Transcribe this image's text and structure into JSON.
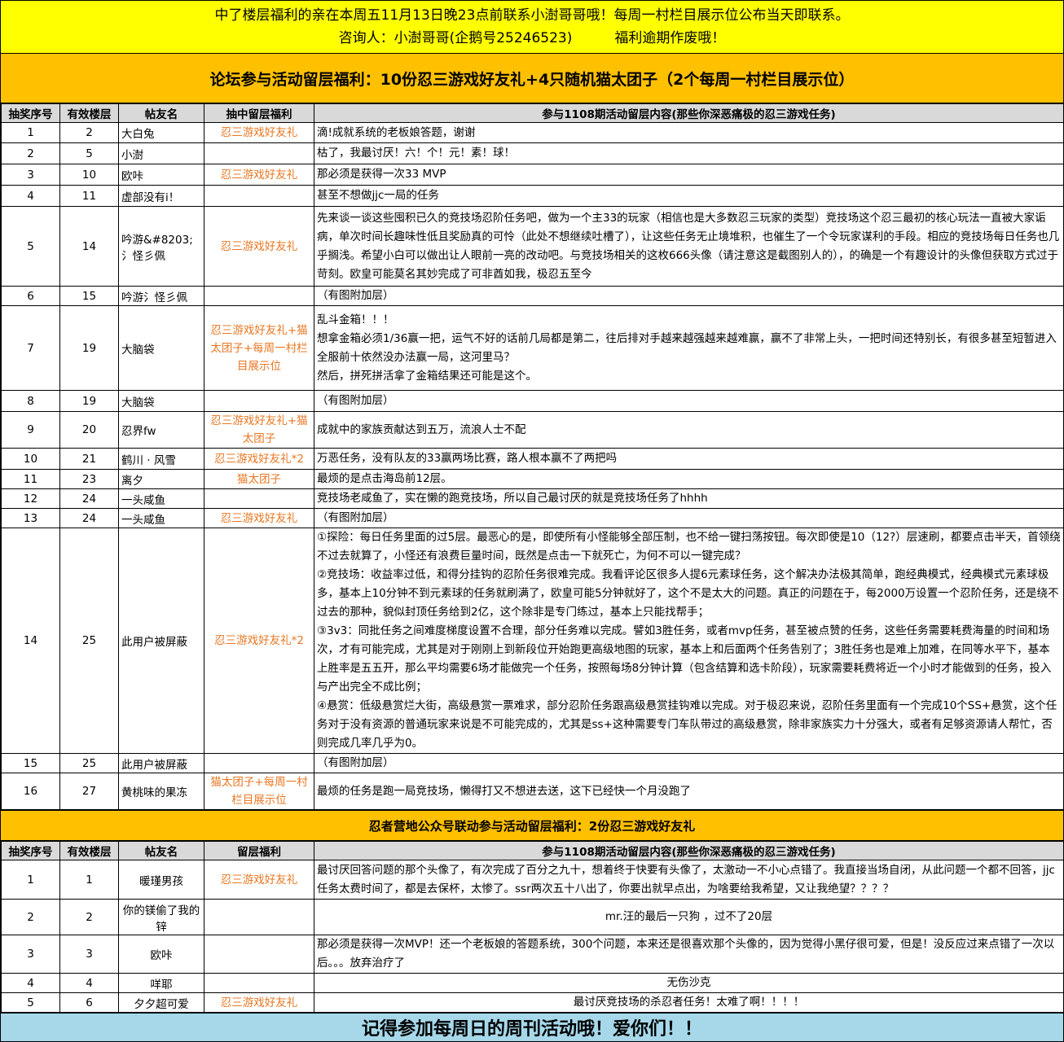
{
  "notice": {
    "line1": "中了楼层福利的亲在本周五11月13日晚23点前联系小澍哥哥哦！每周一村栏目展示位公布当天即联系。",
    "contact": "咨询人：小澍哥哥(企鹅号25246523)",
    "expiry": "福利逾期作废哦！"
  },
  "section1": {
    "title": "论坛参与活动留层福利：10份忍三游戏好友礼+4只随机猫太团子（2个每周一村栏目展示位）",
    "headers": [
      "抽奖序号",
      "有效楼层",
      "帖友名",
      "抽中留层福利",
      "参与1108期活动留层内容(那些你深恶痛极的忍三游戏任务)"
    ],
    "rows": [
      {
        "no": "1",
        "floor": "2",
        "name": "大白兔",
        "prize": "忍三游戏好友礼",
        "content": [
          "滴!成就系统的老板娘答题，谢谢"
        ]
      },
      {
        "no": "2",
        "floor": "5",
        "name": "小澍",
        "prize": "",
        "content": [
          "枯了，我最讨厌！六！个！元！素！球！"
        ]
      },
      {
        "no": "3",
        "floor": "10",
        "name": "欧咔",
        "prize": "忍三游戏好友礼",
        "content": [
          "那必须是获得一次33 MVP"
        ]
      },
      {
        "no": "4",
        "floor": "11",
        "name": "虚部没有i！",
        "prize": "",
        "content": [
          "甚至不想做jjc一局的任务"
        ]
      },
      {
        "no": "5",
        "floor": "14",
        "name": "吟游&#8203;氵怪彡佩",
        "prize": "忍三游戏好友礼",
        "content": [
          "先来谈一谈这些囤积已久的竞技场忍阶任务吧，做为一个主33的玩家（相信也是大多数忍三玩家的类型）竞技场这个忍三最初的核心玩法一直被大家诟病，单次时间长趣味性低且奖励真的可怜（此处不想继续吐槽了），让这些任务无止境堆积，也催生了一个令玩家谋利的手段。相应的竞技场每日任务也几乎搁浅。希望小白可以做出让人眼前一亮的改动吧。与竞技场相关的这枚666头像（请注意这是截图别人的），的确是一个有趣设计的头像但获取方式过于苛刻。欧皇可能莫名其妙完成了可非酋如我，极忍五至今"
        ]
      },
      {
        "no": "6",
        "floor": "15",
        "name": "吟游氵怪彡佩",
        "prize": "",
        "content": [
          "（有图附加层）"
        ]
      },
      {
        "no": "7",
        "floor": "19",
        "name": "大脑袋",
        "prize": "忍三游戏好友礼+猫太团子+每周一村栏目展示位",
        "content": [
          "乱斗金箱！！！",
          "想拿金箱必须1/36赢一把，运气不好的话前几局都是第二，往后排对手越来越强越来越难赢，赢不了非常上头，一把时间还特别长，有很多甚至短暂进入全服前十依然没办法赢一局，这河里马？",
          "然后，拼死拼活拿了金箱结果还可能是这个。"
        ]
      },
      {
        "no": "8",
        "floor": "19",
        "name": "大脑袋",
        "prize": "",
        "content": [
          "（有图附加层）"
        ]
      },
      {
        "no": "9",
        "floor": "20",
        "name": "忍界fw",
        "prize": "忍三游戏好友礼+猫太团子",
        "content": [
          "成就中的家族贡献达到五万，流浪人士不配"
        ]
      },
      {
        "no": "10",
        "floor": "21",
        "name": "鹤川 · 风雪",
        "prize": "忍三游戏好友礼*2",
        "content": [
          "万恶任务，没有队友的33赢两场比赛，路人根本赢不了两把吗"
        ]
      },
      {
        "no": "11",
        "floor": "23",
        "name": "离夕",
        "prize": "猫太团子",
        "content": [
          "最烦的是点击海岛前12层。"
        ]
      },
      {
        "no": "12",
        "floor": "24",
        "name": "一头咸鱼",
        "prize": "",
        "content": [
          "竞技场老咸鱼了，实在懒的跑竞技场，所以自己最讨厌的就是竞技场任务了hhhh"
        ]
      },
      {
        "no": "13",
        "floor": "24",
        "name": "一头咸鱼",
        "prize": "忍三游戏好友礼",
        "content": [
          "（有图附加层）"
        ]
      },
      {
        "no": "14",
        "floor": "25",
        "name": "此用户被屏蔽",
        "prize": "忍三游戏好友礼*2",
        "content": [
          "①探险：每日任务里面的过5层。最恶心的是，即使所有小怪能够全部压制，也不给一键扫荡按钮。每次即使是10（12?）层速刷，都要点击半天，首领绕不过去就算了，小怪还有浪费巨量时间，既然是点击一下就死亡，为何不可以一键完成？",
          "②竞技场：收益率过低，和得分挂钩的忍阶任务很难完成。我看评论区很多人提6元素球任务，这个解决办法极其简单，跑经典模式，经典模式元素球极多，基本上10分钟不到元素球的任务就刷满了，欧皇可能5分钟就好了，这个不是太大的问题。真正的问题在于，每2000万设置一个忍阶任务，还是绕不过去的那种，貌似封顶任务给到2亿，这个除非是专门练过，基本上只能找帮手；",
          "③3v3：同批任务之间难度梯度设置不合理，部分任务难以完成。譬如3胜任务，或者mvp任务，甚至被点赞的任务，这些任务需要耗费海量的时间和场次，才有可能完成，尤其是对于刚刚上到新段位开始跑更高级地图的玩家，基本上和后面两个任务告别了；3胜任务也是难上加难，在同等水平下，基本上胜率是五五开，那么平均需要6场才能做完一个任务，按照每场8分钟计算（包含结算和选卡阶段），玩家需要耗费将近一个小时才能做到的任务，投入与产出完全不成比例；",
          "④悬赏：低级悬赏烂大街，高级悬赏一票难求，部分忍阶任务跟高级悬赏挂钩难以完成。对于极忍来说，忍阶任务里面有一个完成10个SS+悬赏，这个任务对于没有资源的普通玩家来说是不可能完成的，尤其是ss+这种需要专门车队带过的高级悬赏，除非家族实力十分强大，或者有足够资源请人帮忙，否则完成几率几乎为0。"
        ]
      },
      {
        "no": "15",
        "floor": "25",
        "name": "此用户被屏蔽",
        "prize": "",
        "content": [
          "（有图附加层）"
        ]
      },
      {
        "no": "16",
        "floor": "27",
        "name": "黄桃味的果冻",
        "prize": "猫太团子+每周一村栏目展示位",
        "content": [
          "最烦的任务是跑一局竞技场，懒得打又不想进去送，这下已经快一个月没跑了"
        ]
      }
    ]
  },
  "section2": {
    "title": "忍者营地公众号联动参与活动留层福利：2份忍三游戏好友礼",
    "headers": [
      "抽奖序号",
      "有效楼层",
      "帖友名",
      "留层福利",
      "参与1108期活动留层内容(那些你深恶痛极的忍三游戏任务)"
    ],
    "rows": [
      {
        "no": "1",
        "floor": "1",
        "name": "暖瑾男孩",
        "prize": "忍三游戏好友礼",
        "content": [
          "最讨厌回答问题的那个头像了，有次完成了百分之九十，想着终于快要有头像了，太激动一不小心点错了。我直接当场自闭，从此问题一个都不回答，jjc任务太费时间了，都是去保杯，太惨了。ssr两次五十八出了，你要出就早点出，为啥要给我希望，又让我绝望？？？？"
        ]
      },
      {
        "no": "2",
        "floor": "2",
        "name": "你的镁偷了我的锌",
        "prize": "",
        "content": [
          "mr.汪的最后一只狗 ，过不了20层"
        ]
      },
      {
        "no": "3",
        "floor": "3",
        "name": "欧咔",
        "prize": "",
        "content": [
          "那必须是获得一次MVP！还一个老板娘的答题系统，300个问题，本来还是很喜欢那个头像的，因为觉得小黑仔很可爱，但是！没反应过来点错了一次以后。。。放弃治疗了"
        ]
      },
      {
        "no": "4",
        "floor": "4",
        "name": "咩耶",
        "prize": "",
        "content": [
          "无伤沙克"
        ]
      },
      {
        "no": "5",
        "floor": "6",
        "name": "夕夕超可爱",
        "prize": "忍三游戏好友礼",
        "content": [
          "最讨厌竞技场的杀忍者任务！太难了啊！！！！"
        ]
      }
    ]
  },
  "footer": "记得参加每周日的周刊活动哦！爱你们！！"
}
